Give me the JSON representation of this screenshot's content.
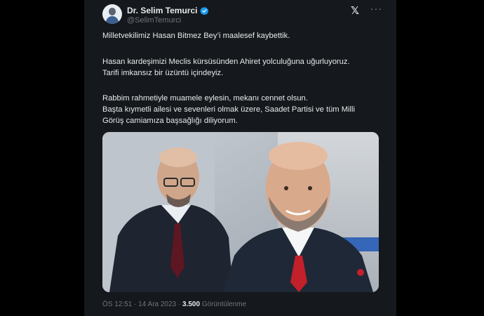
{
  "author": {
    "name": "Dr. Selim Temurci",
    "handle": "@SelimTemurci"
  },
  "tweet": {
    "paragraphs": [
      [
        "Milletvekilimiz Hasan Bitmez Bey’i maalesef kaybettik."
      ],
      [
        "Hasan kardeşimizi Meclis kürsüsünden Ahiret yolculuğuna uğurluyoruz.",
        "Tarifi imkansız bir üzüntü içindeyiz."
      ],
      [
        "Rabbim rahmetiyle muamele eylesin, mekanı cennet olsun.",
        "Başta kıymetli ailesi ve sevenleri olmak üzere, Saadet Partisi ve tüm Milli",
        "Görüş camiamıza başsağlığı diliyorum."
      ]
    ]
  },
  "meta": {
    "time": "ÖS 12:51",
    "separator": "·",
    "date": "14 Ara 2023",
    "views_count": "3.500",
    "views_label": "Görüntülenme"
  },
  "colors": {
    "background": "#15181c",
    "text": "#e7e9ea",
    "muted": "#71767b",
    "verified": "#1d9bf0"
  },
  "icons": [
    "verified-badge-icon",
    "x-logo-icon",
    "more-options-icon"
  ]
}
